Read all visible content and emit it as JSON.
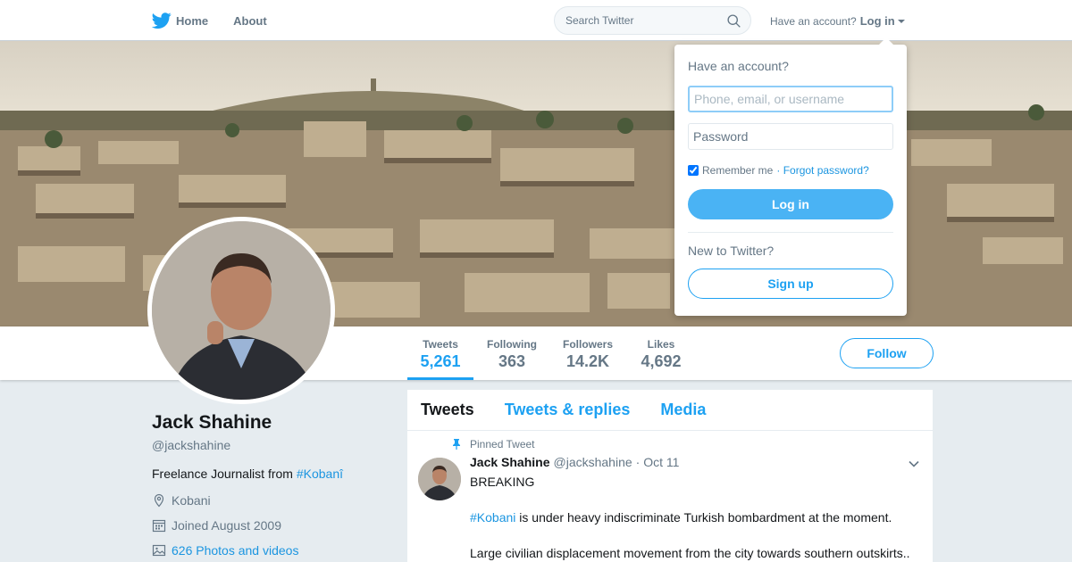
{
  "colors": {
    "brand": "#1da1f2",
    "link": "#1b95e0",
    "muted": "#657786",
    "page_bg": "#e6ecf0",
    "login_button": "#4ab3f4"
  },
  "nav": {
    "logo_icon": "twitter-bird-icon",
    "home_label": "Home",
    "about_label": "About",
    "search_placeholder": "Search Twitter",
    "search_icon": "search-icon",
    "have_account": "Have an account?",
    "login_label": "Log in"
  },
  "profile": {
    "name": "Jack Shahine",
    "handle": "@jackshahine",
    "bio_prefix": "Freelance Journalist from ",
    "bio_hashtag": "#Kobanî",
    "location": "Kobani",
    "joined": "Joined August 2009",
    "photos_videos": "626 Photos and videos",
    "follow_label": "Follow",
    "stats": [
      {
        "label": "Tweets",
        "value": "5,261",
        "active": true
      },
      {
        "label": "Following",
        "value": "363",
        "active": false
      },
      {
        "label": "Followers",
        "value": "14.2K",
        "active": false
      },
      {
        "label": "Likes",
        "value": "4,692",
        "active": false
      }
    ]
  },
  "timeline": {
    "tabs": [
      "Tweets",
      "Tweets & replies",
      "Media"
    ],
    "active_tab": "Tweets",
    "tweet": {
      "pinned_label": "Pinned Tweet",
      "author_name": "Jack Shahine",
      "author_handle": "@jackshahine",
      "time": "· Oct 11",
      "line1": "BREAKING",
      "line2_hashtag": "#Kobani",
      "line2_rest": " is under heavy indiscriminate Turkish bombardment at the moment.",
      "line3": "Large civilian displacement movement from the city towards southern outskirts.."
    }
  },
  "login_dropdown": {
    "title": "Have an account?",
    "username_placeholder": "Phone, email, or username",
    "password_placeholder": "Password",
    "remember_label": "Remember me",
    "remember_checked": true,
    "forgot_label": "· Forgot password?",
    "login_button": "Log in",
    "new_label": "New to Twitter?",
    "signup_button": "Sign up"
  }
}
